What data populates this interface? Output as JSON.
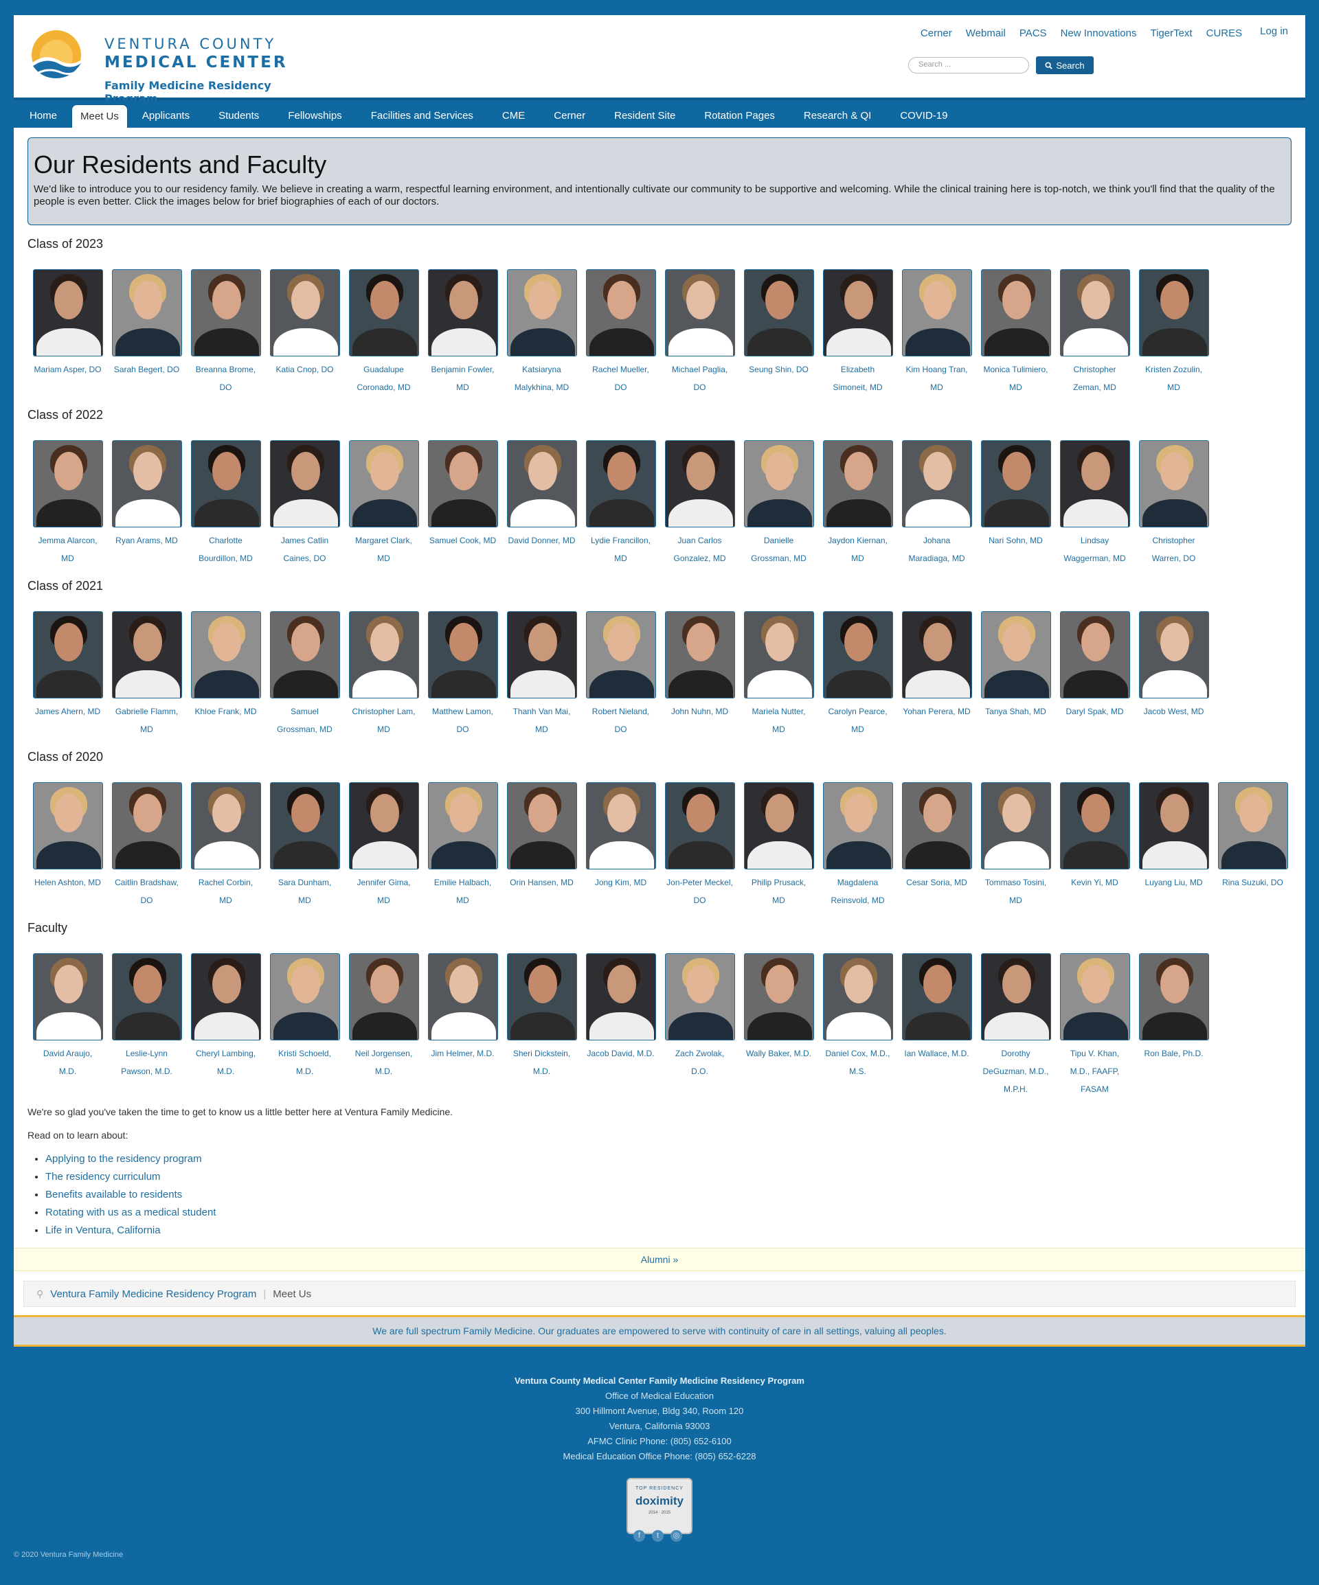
{
  "brand": {
    "line1": "VENTURA COUNTY",
    "line2": "MEDICAL CENTER",
    "line3": "Family Medicine Residency Program"
  },
  "top_links": [
    "Cerner",
    "Webmail",
    "PACS",
    "New Innovations",
    "TigerText",
    "CURES"
  ],
  "login": "Log in",
  "search": {
    "placeholder": "Search ...",
    "button": "Search"
  },
  "nav": [
    "Home",
    "Meet Us",
    "Applicants",
    "Students",
    "Fellowships",
    "Facilities and Services",
    "CME",
    "Cerner",
    "Resident Site",
    "Rotation Pages",
    "Research & QI",
    "COVID-19"
  ],
  "nav_active": "Meet Us",
  "intro": {
    "title": "Our Residents and Faculty",
    "text": "We'd like to introduce you to our residency family.  We believe in creating a warm, respectful learning environment, and intentionally cultivate our community to be supportive and welcoming.  While the clinical training here is top-notch, we think you'll find that the quality of the people is even better.  Click the images below for brief biographies of each of our doctors."
  },
  "sections": [
    {
      "heading": "Class of 2023",
      "people": [
        "Mariam Asper, DO",
        "Sarah Begert, DO",
        "Breanna Brome, DO",
        "Katia Cnop, DO",
        "Guadalupe Coronado, MD",
        "Benjamin Fowler, MD",
        "Katsiaryna Malykhina, MD",
        "Rachel Mueller, DO",
        "Michael Paglia, DO",
        "Seung Shin, DO",
        "Elizabeth Simoneit, MD",
        "Kim Hoang Tran, MD",
        "Monica Tulimiero, MD",
        "Christopher Zeman, MD",
        "Kristen Zozulin, MD"
      ]
    },
    {
      "heading": "Class of 2022",
      "people": [
        "Jemma Alarcon, MD",
        "Ryan Arams, MD",
        "Charlotte Bourdillon, MD",
        "James Catlin Caines, DO",
        "Margaret Clark, MD",
        "Samuel Cook, MD",
        "David Donner, MD",
        "Lydie Francillon, MD",
        "Juan Carlos Gonzalez, MD",
        "Danielle Grossman, MD",
        "Jaydon Kiernan, MD",
        "Johana Maradiaga, MD",
        "Nari Sohn, MD",
        "Lindsay Waggerman, MD",
        "Christopher Warren, DO"
      ]
    },
    {
      "heading": "Class of 2021",
      "people": [
        "James Ahern, MD",
        "Gabrielle Flamm, MD",
        "Khloe Frank, MD",
        "Samuel Grossman, MD",
        "Christopher Lam, MD",
        "Matthew Lamon, DO",
        "Thanh Van Mai, MD",
        "Robert Nieland, DO",
        "John Nuhn, MD",
        "Mariela Nutter, MD",
        "Carolyn Pearce, MD",
        "Yohan Perera, MD",
        "Tanya Shah, MD",
        "Daryl Spak, MD",
        "Jacob West, MD"
      ]
    },
    {
      "heading": "Class of 2020",
      "people": [
        "Helen Ashton, MD",
        "Caitlin Bradshaw, DO",
        "Rachel Corbin, MD",
        "Sara Dunham, MD",
        "Jennifer Gima, MD",
        "Emilie Halbach, MD",
        "Orin Hansen, MD",
        "Jong Kim, MD",
        "Jon-Peter Meckel, DO",
        "Philip Prusack, MD",
        "Magdalena Reinsvold, MD",
        "Cesar Soria, MD",
        "Tommaso Tosini, MD",
        "Kevin Yi, MD",
        "Luyang Liu, MD",
        "Rina Suzuki, DO"
      ]
    },
    {
      "heading": "Faculty",
      "people": [
        "David Araujo, M.D.",
        "Leslie-Lynn Pawson, M.D.",
        "Cheryl Lambing, M.D.",
        "Kristi Schoeld, M.D.",
        "Neil Jorgensen, M.D.",
        "Jim Helmer, M.D.",
        "Sheri Dickstein, M.D.",
        "Jacob David, M.D.",
        "Zach Zwolak, D.O.",
        "Wally Baker, M.D.",
        "Daniel Cox, M.D., M.S.",
        "Ian Wallace, M.D.",
        "Dorothy DeGuzman, M.D., M.P.H.",
        "Tipu V. Khan, M.D., FAAFP, FASAM",
        "Ron Bale, Ph.D."
      ]
    }
  ],
  "outro": {
    "glad": "We're so glad you've taken the time to get to know us a little better here at Ventura Family Medicine.",
    "read_on": "Read on to learn about:",
    "links": [
      "Applying to the residency program",
      "The residency curriculum",
      "Benefits available to residents",
      "Rotating with us as a medical student",
      "Life in Ventura, California"
    ]
  },
  "alumni": "Alumni »",
  "breadcrumb": {
    "root": "Ventura Family Medicine Residency Program",
    "current": "Meet Us"
  },
  "motto": "We are full spectrum Family Medicine. Our graduates are empowered to serve with continuity of care in all settings, valuing all peoples.",
  "footer": {
    "org": "Ventura County Medical Center Family Medicine Residency Program",
    "lines": [
      "Office of Medical Education",
      "300 Hillmont Avenue, Bldg 340, Room 120",
      "Ventura, California 93003",
      "AFMC Clinic Phone: (805) 652-6100",
      "Medical Education Office Phone: (805) 652-6228"
    ],
    "badge_top": "TOP RESIDENCY",
    "badge_name": "doximity",
    "badge_years": "2014 · 2015",
    "copyright": "© 2020 Ventura Family Medicine"
  },
  "colors": {
    "brand_blue": "#0f68a0",
    "link": "#1f6ea0",
    "accent_gold": "#f0b43a"
  }
}
